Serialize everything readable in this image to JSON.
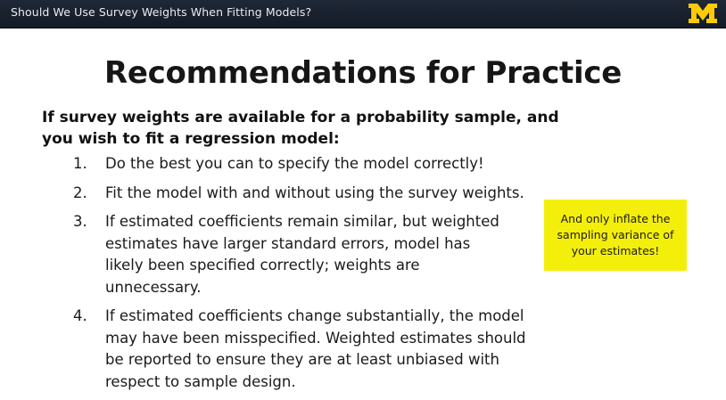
{
  "header": {
    "title": "Should We Use Survey Weights When Fitting Models?",
    "logo_text": "M",
    "brand_color": "#ffcb05"
  },
  "slide": {
    "title": "Recommendations for Practice",
    "intro": "If survey weights are available for a probability sample, and you wish to fit a regression model:",
    "items": [
      {
        "num": "1.",
        "text": "Do the best you can to specify the model correctly!"
      },
      {
        "num": "2.",
        "text": "Fit the model with and without using the survey weights."
      },
      {
        "num": "3.",
        "text": "If estimated coefficients remain similar, but weighted estimates have larger standard errors, model has likely been specified correctly; weights are unnecessary."
      },
      {
        "num": "4.",
        "text": "If estimated coefficients change substantially, the model may have been misspecified. Weighted estimates should be reported to ensure they are at least unbiased with respect to sample design."
      }
    ],
    "callout": "And only inflate the sampling variance of your estimates!",
    "callout_color": "#f4ef0a"
  }
}
